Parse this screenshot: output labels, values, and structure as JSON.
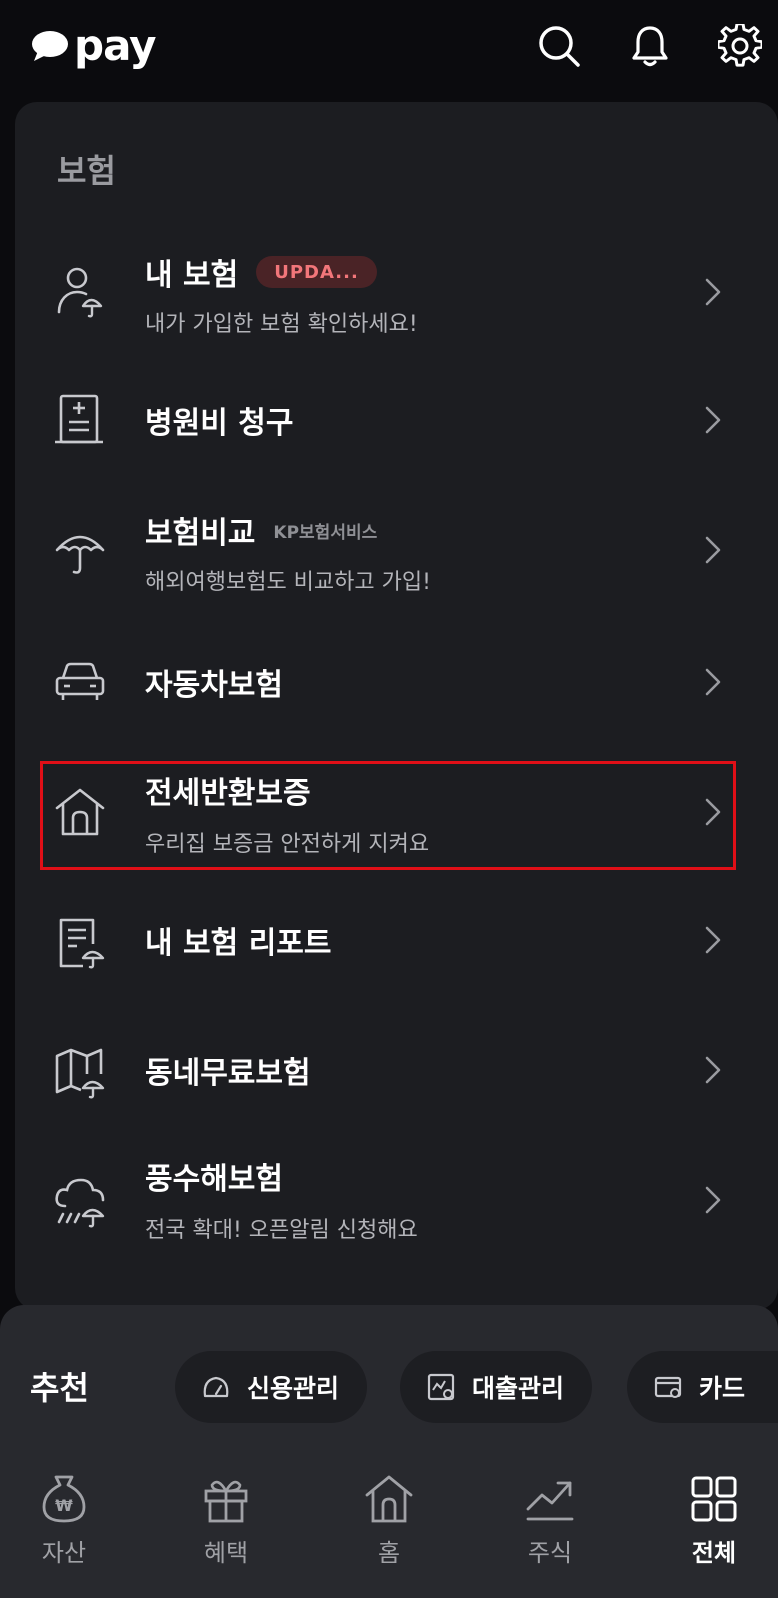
{
  "header": {
    "logo_text": "pay",
    "icons": [
      "search-icon",
      "bell-icon",
      "gear-icon"
    ]
  },
  "insurance": {
    "section_title": "보험",
    "items": [
      {
        "title": "내 보험",
        "badge": "UPDA...",
        "subtitle": "내가 가입한 보험 확인하세요!",
        "icon": "person-umbrella-icon"
      },
      {
        "title": "병원비 청구",
        "icon": "medical-document-icon"
      },
      {
        "title": "보험비교",
        "tag": "KP보험서비스",
        "subtitle": "해외여행보험도 비교하고 가입!",
        "icon": "umbrella-icon"
      },
      {
        "title": "자동차보험",
        "icon": "car-icon"
      },
      {
        "title": "전세반환보증",
        "subtitle": "우리집 보증금 안전하게 지켜요",
        "icon": "house-icon"
      },
      {
        "title": "내 보험 리포트",
        "icon": "report-umbrella-icon"
      },
      {
        "title": "동네무료보험",
        "icon": "map-umbrella-icon"
      },
      {
        "title": "풍수해보험",
        "subtitle": "전국 확대! 오픈알림 신청해요",
        "icon": "storm-umbrella-icon"
      }
    ]
  },
  "recommend": {
    "label": "추천",
    "chips": [
      {
        "label": "신용관리",
        "icon": "gauge-icon"
      },
      {
        "label": "대출관리",
        "icon": "loan-chart-icon"
      },
      {
        "label": "카드",
        "icon": "card-icon"
      }
    ]
  },
  "nav": {
    "items": [
      {
        "label": "자산",
        "icon": "money-bag-icon"
      },
      {
        "label": "혜택",
        "icon": "gift-icon"
      },
      {
        "label": "홈",
        "icon": "home-icon"
      },
      {
        "label": "주식",
        "icon": "stock-chart-icon"
      },
      {
        "label": "전체",
        "icon": "grid-icon",
        "active": true
      }
    ]
  },
  "colors": {
    "background": "#0b0b0e",
    "card": "#1c1d21",
    "highlight": "#e00f17",
    "badge_bg": "#4a2326",
    "badge_text": "#f2767a"
  }
}
